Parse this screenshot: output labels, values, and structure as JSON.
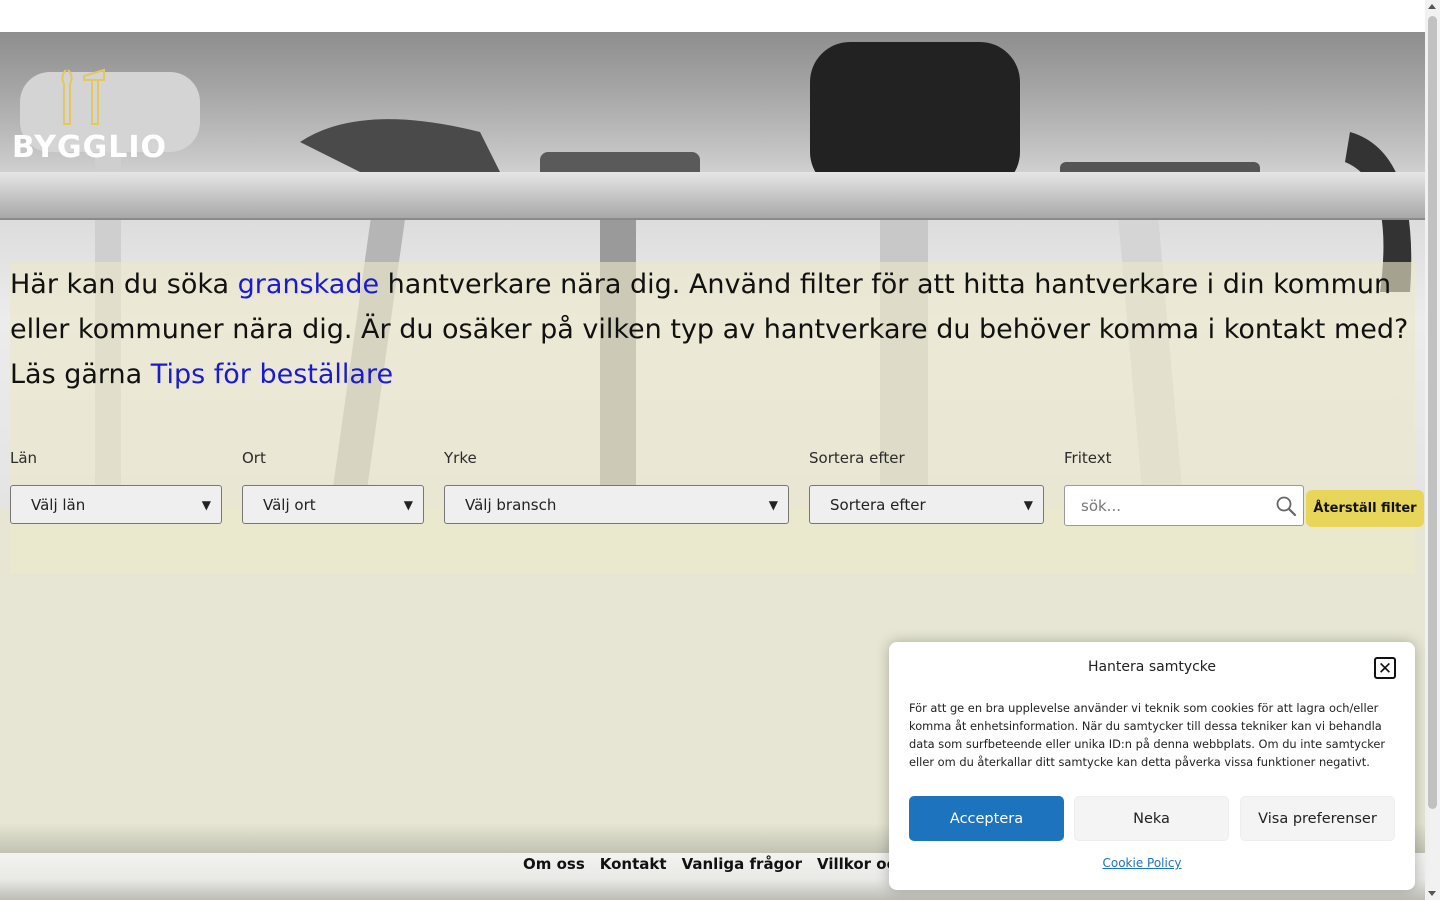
{
  "brand": {
    "name": "BYGGLIO"
  },
  "intro": {
    "part1": "Här kan du söka ",
    "link1": "granskade",
    "part2": " hantverkare nära dig. Använd filter för att hitta hantverkare i din kommun eller kommuner nära dig. Är du osäker på vilken typ av hantverkare du behöver komma i kontakt med? Läs gärna ",
    "link2": "Tips för beställare"
  },
  "filters": {
    "lan": {
      "label": "Län",
      "selected": "Välj län"
    },
    "ort": {
      "label": "Ort",
      "selected": "Välj ort"
    },
    "yrke": {
      "label": "Yrke",
      "selected": "Välj bransch"
    },
    "sort": {
      "label": "Sortera efter",
      "selected": "Sortera efter"
    },
    "fritext": {
      "label": "Fritext",
      "placeholder": "sök..."
    },
    "reset_label": "Återställ filter"
  },
  "footer": {
    "links": [
      "Om oss",
      "Kontakt",
      "Vanliga frågor",
      "Villkor och regler"
    ]
  },
  "consent": {
    "title": "Hantera samtycke",
    "body": "För att ge en bra upplevelse använder vi teknik som cookies för att lagra och/eller komma åt enhetsinformation. När du samtycker till dessa tekniker kan vi behandla data som surfbeteende eller unika ID:n på denna webbplats. Om du inte samtycker eller om du återkallar ditt samtycke kan detta påverka vissa funktioner negativt.",
    "accept_label": "Acceptera",
    "deny_label": "Neka",
    "prefs_label": "Visa preferenser",
    "policy_label": "Cookie Policy"
  },
  "colors": {
    "link": "#1a1ad0",
    "accent_yellow": "#e8d65a",
    "accept_blue": "#1e73be",
    "panel": "#e7e6d4"
  }
}
